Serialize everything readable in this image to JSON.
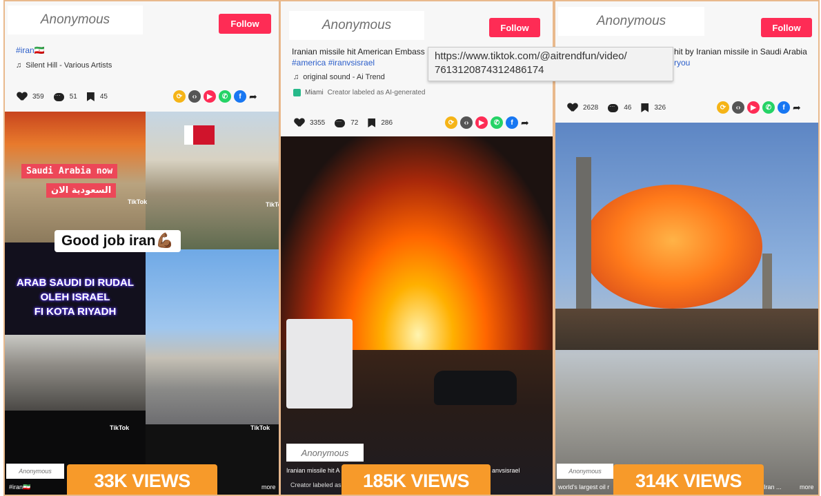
{
  "url_tooltip": {
    "line1": "https://www.tiktok.com/@aitrendfun/video/",
    "line2": "7613120874312486174"
  },
  "posts": [
    {
      "author": "Anonymous",
      "follow_label": "Follow",
      "hashtag": "#iran🇮🇷",
      "sound": "Silent Hill - Various Artists",
      "likes": "359",
      "comments": "51",
      "saves": "45",
      "overlays": {
        "banner_en": "Saudi Arabia now",
        "banner_ar": "السعودية الان",
        "goodjob": "Good job iran💪🏾",
        "arab_line1": "ARAB SAUDI DI RUDAL",
        "arab_line2": "OLEH ISRAEL",
        "arab_line3": "FI KOTA RIYADH",
        "tiktok": "TikTok"
      },
      "bottom_author": "Anonymous",
      "bottom_caption": "#iran🇮🇷",
      "more": "more",
      "views": "33K VIEWS"
    },
    {
      "author": "Anonymous",
      "follow_label": "Follow",
      "caption": "Iranian missile hit American Embass",
      "hashtags": "#america #iranvsisrael",
      "sound": "original sound - Ai Trend",
      "location": "Miami",
      "ai_label": "Creator labeled as AI-generated",
      "likes": "3355",
      "comments": "72",
      "saves": "286",
      "bottom_author": "Anonymous",
      "bottom_caption_left": "Iranian missile hit A",
      "bottom_caption_right": "anvsisrael",
      "bottom_caption2": "Creator labeled as A",
      "views": "185K VIEWS"
    },
    {
      "author": "Anonymous",
      "follow_label": "Follow",
      "caption": "hit by Iranian missile in Saudi Arabia",
      "hashtags": "ryou",
      "likes": "2628",
      "comments": "46",
      "saves": "326",
      "bottom_author": "Anonymous",
      "bottom_caption_left": "world's largest oil r",
      "bottom_caption_right": "Iran ...",
      "more": "more",
      "views": "314K VIEWS"
    }
  ],
  "colors": {
    "follow": "#fe2c55",
    "views_badge": "#f79a2a",
    "hashtag": "#2a5dc9",
    "frame": "#e9b98c"
  }
}
